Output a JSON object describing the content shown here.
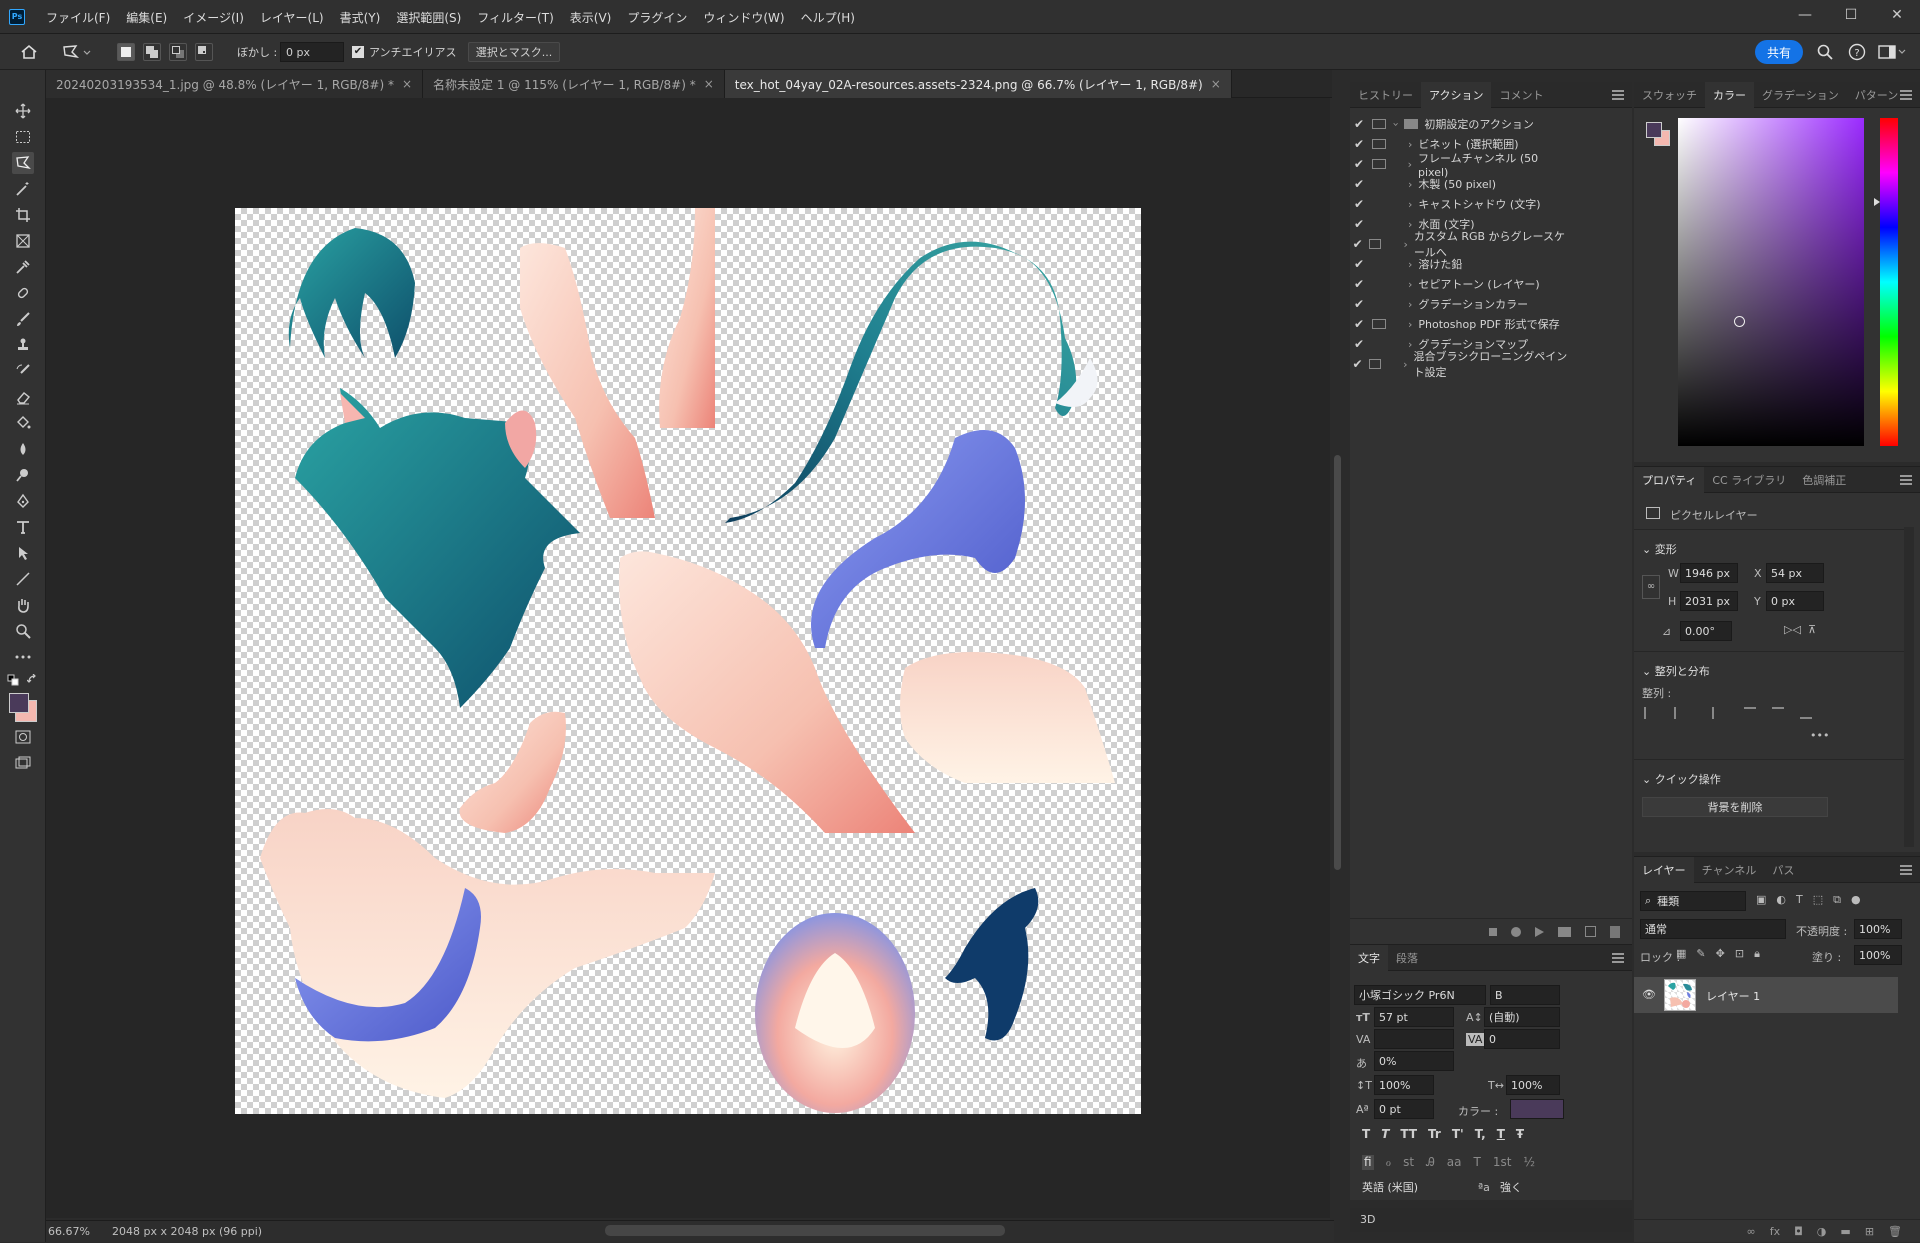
{
  "app": {
    "logo": "Ps"
  },
  "menubar": {
    "items": [
      "ファイル(F)",
      "編集(E)",
      "イメージ(I)",
      "レイヤー(L)",
      "書式(Y)",
      "選択範囲(S)",
      "フィルター(T)",
      "表示(V)",
      "プラグイン",
      "ウィンドウ(W)",
      "ヘルプ(H)"
    ],
    "window_controls": [
      "—",
      "☐",
      "✕"
    ]
  },
  "options": {
    "feather_label": "ぼかし :",
    "feather_value": "0 px",
    "antialias_label": "アンチエイリアス",
    "antialias_checked": true,
    "select_mask_label": "選択とマスク...",
    "share_label": "共有"
  },
  "tabs": [
    {
      "label": "20240203193534_1.jpg @ 48.8% (レイヤー 1, RGB/8#) *",
      "close": "×"
    },
    {
      "label": "名称未設定 1 @ 115% (レイヤー 1, RGB/8#) *",
      "close": "×"
    },
    {
      "label": "tex_hot_04yay_02A-resources.assets-2324.png @ 66.7% (レイヤー 1, RGB/8#)",
      "close": "×",
      "active": true
    }
  ],
  "status": {
    "zoom": "66.67%",
    "doc_info": "2048 px x 2048 px (96 ppi)"
  },
  "actions_panel": {
    "tabs": [
      "ヒストリー",
      "アクション",
      "コメント"
    ],
    "active_tab": "アクション",
    "set_name": "初期設定のアクション",
    "items": [
      {
        "label": "ビネット (選択範囲)",
        "dialog": true
      },
      {
        "label": "フレームチャンネル (50 pixel)",
        "dialog": true
      },
      {
        "label": "木製 (50 pixel)",
        "dialog": false
      },
      {
        "label": "キャストシャドウ (文字)",
        "dialog": false
      },
      {
        "label": "水面 (文字)",
        "dialog": false
      },
      {
        "label": "カスタム RGB からグレースケールへ",
        "dialog": true
      },
      {
        "label": "溶けた鉛",
        "dialog": false
      },
      {
        "label": "セピアトーン (レイヤー)",
        "dialog": false
      },
      {
        "label": "グラデーションカラー",
        "dialog": false
      },
      {
        "label": "Photoshop PDF 形式で保存",
        "dialog": true
      },
      {
        "label": "グラデーションマップ",
        "dialog": false
      },
      {
        "label": "混合ブラシクローニングペイント設定",
        "dialog": true
      }
    ],
    "check": "✔",
    "chevron": "›"
  },
  "character_panel": {
    "tabs": [
      "文字",
      "段落"
    ],
    "active_tab": "文字",
    "font_family": "小塚ゴシック Pr6N",
    "font_style": "B",
    "font_size": "57 pt",
    "leading": "(自動)",
    "kerning": "",
    "tracking": "0",
    "tsume": "0%",
    "vscale": "100%",
    "hscale": "100%",
    "baseline": "0 pt",
    "color_label": "カラー :",
    "color": "#4a3a5a",
    "language": "英語 (米国)",
    "aa_label": "ªa",
    "aa_value": "強く",
    "style_buttons": [
      "T",
      "T",
      "TT",
      "Tr",
      "T'",
      "T,",
      "T",
      "Ŧ"
    ],
    "ot_buttons": [
      "fi",
      "ℴ",
      "st",
      "Ꭿ",
      "aa",
      "T",
      "1st",
      "½"
    ]
  },
  "bottom_tab": "3D",
  "color_panel": {
    "tabs": [
      "スウォッチ",
      "カラー",
      "グラデーション",
      "パターン"
    ],
    "active_tab": "カラー",
    "fg": "#4a3a5a",
    "bg": "#f4b8b0",
    "hue": "#9b2bff"
  },
  "properties": {
    "tabs": [
      "プロパティ",
      "CC ライブラリ",
      "色調補正"
    ],
    "active_tab": "プロパティ",
    "layer_type": "ピクセルレイヤー",
    "transform_header": "変形",
    "w_label": "W",
    "w": "1946 px",
    "x_label": "X",
    "x": "54 px",
    "h_label": "H",
    "h": "2031 px",
    "y_label": "Y",
    "y": "0 px",
    "angle": "0.00°",
    "align_header": "整列と分布",
    "align_label": "整列 :",
    "quick_header": "クイック操作",
    "remove_bg": "背景を削除",
    "more": "•••"
  },
  "layers": {
    "tabs": [
      "レイヤー",
      "チャンネル",
      "パス"
    ],
    "active_tab": "レイヤー",
    "filter_kind": "種類",
    "blend_mode": "通常",
    "opacity_label": "不透明度 :",
    "opacity": "100%",
    "lock_label": "ロック :",
    "fill_label": "塗り :",
    "fill": "100%",
    "items": [
      {
        "name": "レイヤー 1",
        "visible": true
      }
    ]
  }
}
